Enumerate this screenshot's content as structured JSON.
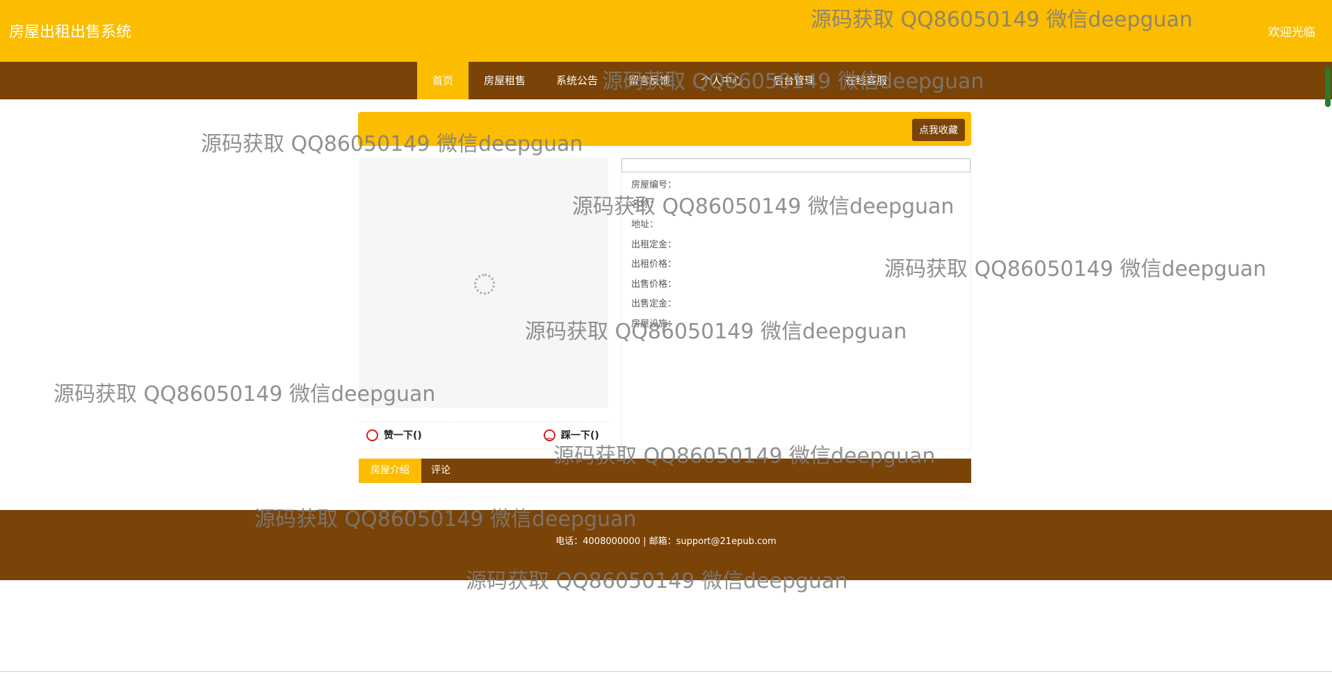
{
  "header": {
    "site_title": "房屋出租出售系统",
    "welcome": "欢迎光临"
  },
  "nav": {
    "items": [
      "首页",
      "房屋租售",
      "系统公告",
      "留言反馈",
      "个人中心",
      "后台管理",
      "在线客服"
    ],
    "active_index": 0
  },
  "detail": {
    "favorite_button": "点我收藏",
    "fields": [
      "房屋编号：",
      "名称：",
      "地址：",
      "出租定金：",
      "出租价格：",
      "出售价格：",
      "出售定金：",
      "房屋设施："
    ],
    "like_label": "赞一下()",
    "dislike_label": "踩一下()"
  },
  "tabs": {
    "items": [
      "房屋介绍",
      "评论"
    ],
    "active_index": 0
  },
  "footer": {
    "text": "电话：4008000000 | 邮箱：support@21epub.com"
  },
  "watermark": {
    "text": "源码获取 QQ86050149 微信deepguan"
  },
  "colors": {
    "accent": "#fcbd00",
    "brand_dark": "#7a4307"
  }
}
